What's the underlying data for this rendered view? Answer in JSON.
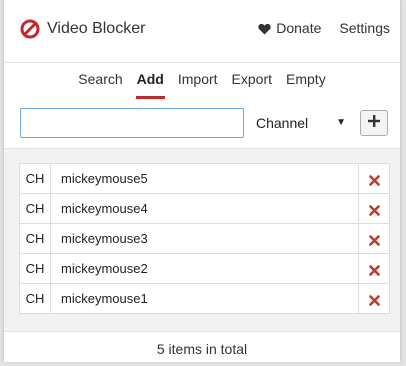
{
  "header": {
    "title": "Video Blocker",
    "donate_label": "Donate",
    "settings_label": "Settings"
  },
  "tabs": [
    {
      "label": "Search",
      "active": false
    },
    {
      "label": "Add",
      "active": true
    },
    {
      "label": "Import",
      "active": false
    },
    {
      "label": "Export",
      "active": false
    },
    {
      "label": "Empty",
      "active": false
    }
  ],
  "add_form": {
    "input_value": "",
    "input_placeholder": "",
    "type_selected": "Channel",
    "add_button_icon": "plus-icon"
  },
  "items": [
    {
      "type": "CH",
      "name": "mickeymouse5"
    },
    {
      "type": "CH",
      "name": "mickeymouse4"
    },
    {
      "type": "CH",
      "name": "mickeymouse3"
    },
    {
      "type": "CH",
      "name": "mickeymouse2"
    },
    {
      "type": "CH",
      "name": "mickeymouse1"
    }
  ],
  "footer": {
    "count_text": "5 items in total"
  },
  "colors": {
    "brand_red": "#c1272d",
    "remove_red": "#c0392b",
    "input_border": "#6aa8e0"
  }
}
